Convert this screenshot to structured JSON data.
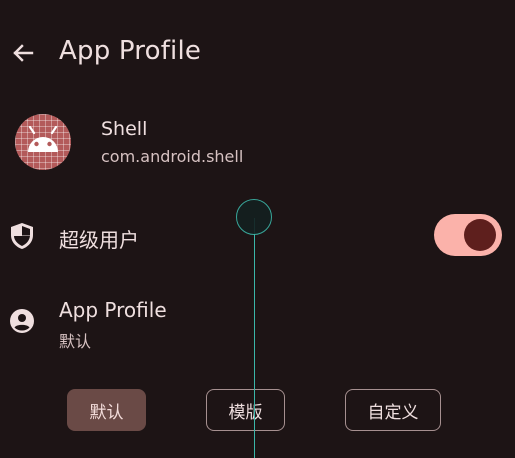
{
  "header": {
    "title": "App Profile"
  },
  "app": {
    "name": "Shell",
    "package": "com.android.shell"
  },
  "superuser": {
    "label": "超级用户",
    "enabled": true
  },
  "profile": {
    "title": "App Profile",
    "value": "默认"
  },
  "profile_options": [
    "默认",
    "模版",
    "自定义"
  ],
  "colors": {
    "background": "#1d1415",
    "switch_track": "#fbb2aa",
    "switch_thumb": "#5e1f1d",
    "selected_segment": "#6a4a46",
    "touch_indicator": "#3bb6a8"
  }
}
